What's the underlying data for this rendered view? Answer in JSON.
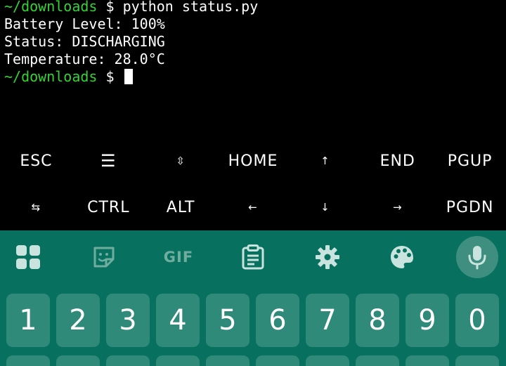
{
  "terminal": {
    "lines": [
      {
        "path": "~/downloads",
        "dollar": " $ ",
        "command": "python status.py"
      },
      {
        "text": "Battery Level: 100%"
      },
      {
        "text": "Status: DISCHARGING"
      },
      {
        "text": "Temperature: 28.0°C"
      },
      {
        "path": "~/downloads",
        "dollar": " $ ",
        "command": ""
      }
    ],
    "colors": {
      "prompt": "#35d235",
      "text": "#ffffff",
      "background": "#000000"
    }
  },
  "extra_keys": {
    "row1": [
      "ESC",
      "☰",
      "⇳",
      "HOME",
      "↑",
      "END",
      "PGUP"
    ],
    "row2": [
      "⇆",
      "CTRL",
      "ALT",
      "←",
      "↓",
      "→",
      "PGDN"
    ]
  },
  "keyboard": {
    "toolbar_icons": [
      "apps-grid-icon",
      "sticker-icon",
      "gif-icon",
      "clipboard-icon",
      "settings-gear-icon",
      "palette-icon",
      "microphone-icon"
    ],
    "toolbar_gif_label": "GIF",
    "number_keys": [
      "1",
      "2",
      "3",
      "4",
      "5",
      "6",
      "7",
      "8",
      "9",
      "0"
    ],
    "colors": {
      "background": "#08705e",
      "key": "#2f8a7a",
      "icon": "#c9e4de",
      "mic_bg": "#3f8f80"
    }
  }
}
